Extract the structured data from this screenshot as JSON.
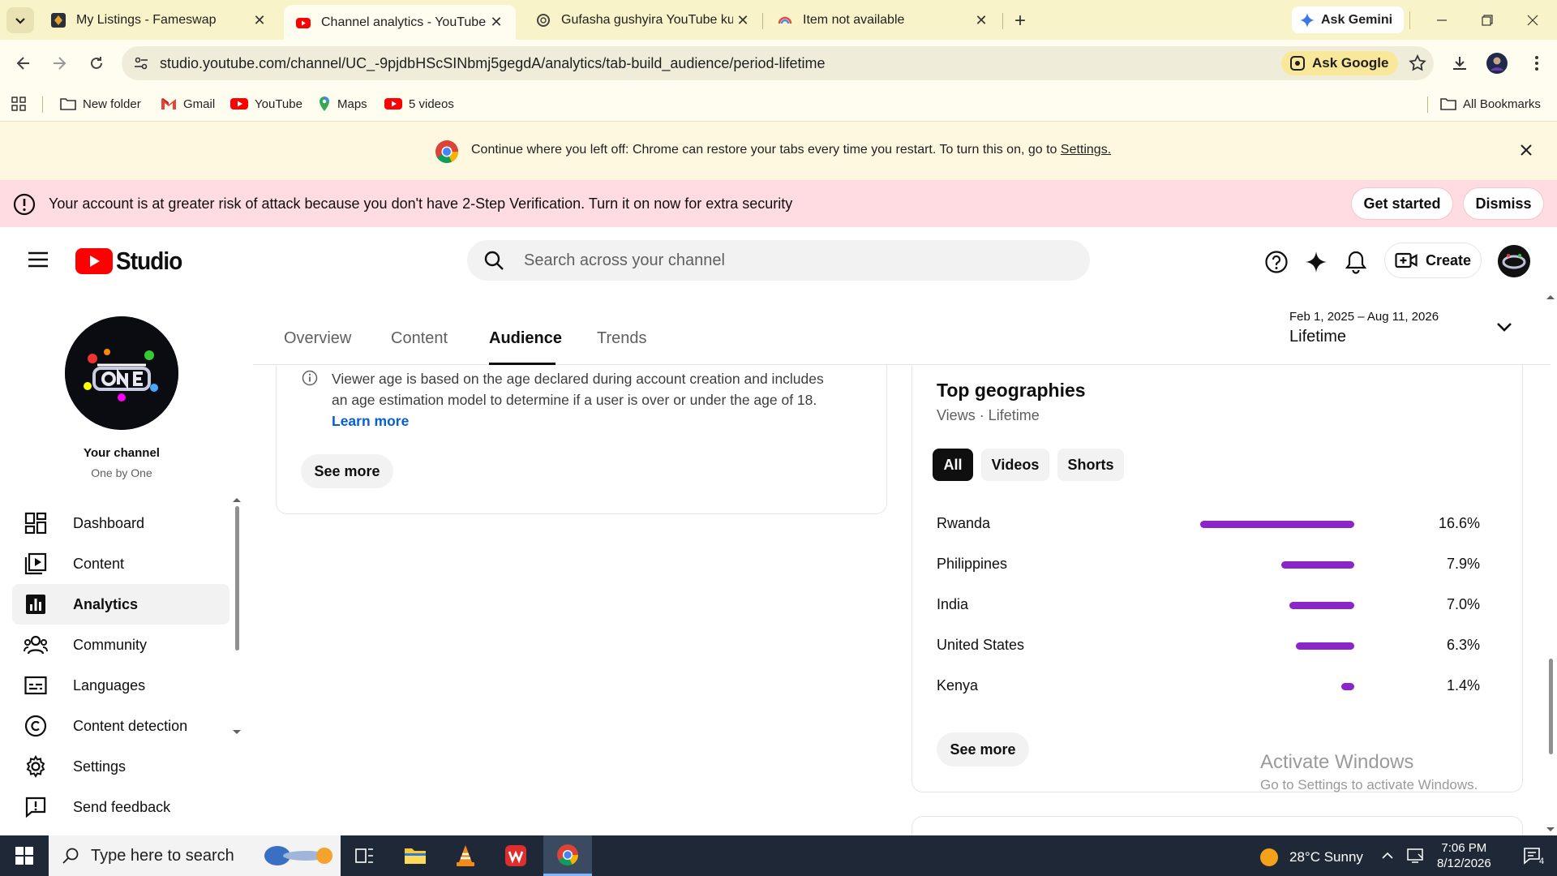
{
  "browser": {
    "tabs": [
      {
        "title": "My Listings - Fameswap",
        "active": false
      },
      {
        "title": "Channel analytics - YouTube Studio",
        "active": true
      },
      {
        "title": "Gufasha gushyira YouTube kuri",
        "active": false
      },
      {
        "title": "Item not available",
        "active": false
      }
    ],
    "ask_gemini": "Ask Gemini",
    "url": "studio.youtube.com/channel/UC_-9pjdbHScSINbmj5gegdA/analytics/tab-build_audience/period-lifetime",
    "ask_google": "Ask Google",
    "bookmarks": [
      "New folder",
      "Gmail",
      "YouTube",
      "Maps",
      "5 videos"
    ],
    "all_bookmarks": "All Bookmarks",
    "infobar": {
      "text": "Continue where you left off: Chrome can restore your tabs every time you restart. To turn this on, go to",
      "link": "Settings."
    }
  },
  "security_banner": {
    "text": "Your account is at greater risk of attack because you don't have 2-Step Verification. Turn it on now for extra security",
    "get_started": "Get started",
    "dismiss": "Dismiss"
  },
  "studio": {
    "logo_text": "Studio",
    "search_placeholder": "Search across your channel",
    "create_label": "Create"
  },
  "sidebar": {
    "channel_title": "Your channel",
    "channel_name": "One by One",
    "items": [
      {
        "label": "Dashboard",
        "icon": "dashboard-icon",
        "active": false
      },
      {
        "label": "Content",
        "icon": "content-icon",
        "active": false
      },
      {
        "label": "Analytics",
        "icon": "analytics-icon",
        "active": true
      },
      {
        "label": "Community",
        "icon": "community-icon",
        "active": false
      },
      {
        "label": "Languages",
        "icon": "subtitles-icon",
        "active": false
      },
      {
        "label": "Content detection",
        "icon": "copyright-icon",
        "active": false
      },
      {
        "label": "Settings",
        "icon": "gear-icon",
        "active": false
      },
      {
        "label": "Send feedback",
        "icon": "feedback-icon",
        "active": false
      }
    ]
  },
  "analytics": {
    "tabs": [
      "Overview",
      "Content",
      "Audience",
      "Trends"
    ],
    "active_tab": "Audience",
    "date_range": "Feb 1, 2025 – Aug 11, 2026",
    "period": "Lifetime"
  },
  "age_card": {
    "note": "Viewer age is based on the age declared during account creation and includes an age estimation model to determine if a user is over or under the age of 18.",
    "learn_more": "Learn more",
    "see_more": "See more"
  },
  "geo_card": {
    "title": "Top geographies",
    "subtitle": "Views · Lifetime",
    "chips": [
      "All",
      "Videos",
      "Shorts"
    ],
    "active_chip": "All",
    "rows": [
      {
        "country": "Rwanda",
        "value": "16.6%",
        "pct": 16.6
      },
      {
        "country": "Philippines",
        "value": "7.9%",
        "pct": 7.9
      },
      {
        "country": "India",
        "value": "7.0%",
        "pct": 7.0
      },
      {
        "country": "United States",
        "value": "6.3%",
        "pct": 6.3
      },
      {
        "country": "Kenya",
        "value": "1.4%",
        "pct": 1.4
      }
    ],
    "bar_color": "#8b27c9",
    "see_more": "See more"
  },
  "watermark": {
    "line1": "Activate Windows",
    "line2": "Go to Settings to activate Windows."
  },
  "taskbar": {
    "search_placeholder": "Type here to search",
    "weather": "28°C  Sunny",
    "time": "7:06 PM",
    "date": "8/12/2026",
    "notifications": "4"
  }
}
